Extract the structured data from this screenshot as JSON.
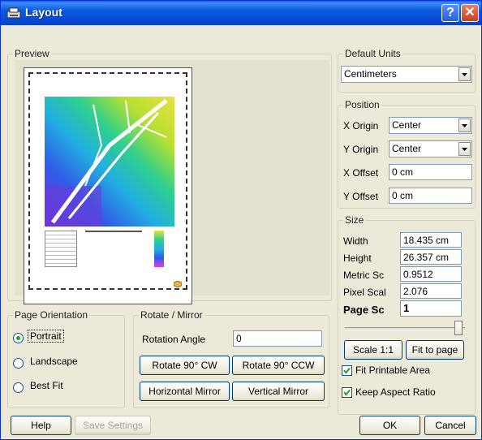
{
  "window": {
    "title": "Layout",
    "help_glyph": "?",
    "close_glyph": "✕"
  },
  "preview": {
    "label": "Preview"
  },
  "default_units": {
    "label": "Default Units",
    "value": "Centimeters"
  },
  "position": {
    "label": "Position",
    "x_origin_label": "X Origin",
    "x_origin_value": "Center",
    "y_origin_label": "Y Origin",
    "y_origin_value": "Center",
    "x_offset_label": "X Offset",
    "x_offset_value": "0 cm",
    "y_offset_label": "Y Offset",
    "y_offset_value": "0 cm"
  },
  "size": {
    "label": "Size",
    "width_label": "Width",
    "width_value": "18.435 cm",
    "height_label": "Height",
    "height_value": "26.357 cm",
    "metric_label": "Metric Sc",
    "metric_value": "0.9512",
    "pixel_label": "Pixel Scal",
    "pixel_value": "2.076",
    "page_label": "Page Sc",
    "page_value": "1",
    "slider_position": 0.98,
    "scale_button": "Scale 1:1",
    "fit_button": "Fit to page",
    "fit_printable_label": "Fit Printable Area",
    "keep_aspect_label": "Keep Aspect Ratio"
  },
  "orientation": {
    "label": "Page Orientation",
    "portrait": "Portrait",
    "landscape": "Landscape",
    "bestfit": "Best Fit",
    "selected": "Portrait"
  },
  "rotate": {
    "label": "Rotate / Mirror",
    "angle_label": "Rotation Angle",
    "angle_value": "0",
    "cw": "Rotate 90° CW",
    "ccw": "Rotate 90° CCW",
    "hmirror": "Horizontal Mirror",
    "vmirror": "Vertical Mirror"
  },
  "footer": {
    "help": "Help",
    "save": "Save Settings",
    "ok": "OK",
    "cancel": "Cancel"
  },
  "colors": {
    "title_bar": "#0a5ae0",
    "dialog_bg": "#ece9d8",
    "check_green": "#21a121"
  }
}
